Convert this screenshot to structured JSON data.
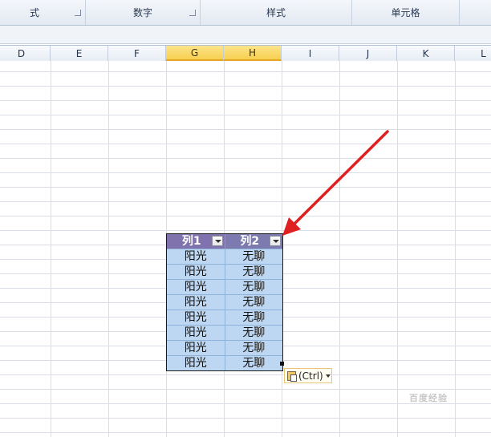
{
  "ribbon": {
    "groups": [
      {
        "label": "式",
        "has_launcher": true
      },
      {
        "label": "数字",
        "has_launcher": true
      },
      {
        "label": "样式",
        "has_launcher": false
      },
      {
        "label": "单元格",
        "has_launcher": false
      }
    ]
  },
  "columns": [
    "D",
    "E",
    "F",
    "G",
    "H",
    "I",
    "J",
    "K",
    "L"
  ],
  "selected_columns": [
    "G",
    "H"
  ],
  "table": {
    "headers": [
      "列1",
      "列2"
    ],
    "rows": [
      [
        "阳光",
        "无聊"
      ],
      [
        "阳光",
        "无聊"
      ],
      [
        "阳光",
        "无聊"
      ],
      [
        "阳光",
        "无聊"
      ],
      [
        "阳光",
        "无聊"
      ],
      [
        "阳光",
        "无聊"
      ],
      [
        "阳光",
        "无聊"
      ],
      [
        "阳光",
        "无聊"
      ]
    ],
    "header_color": "#7f72ad",
    "row_color": "#bdd7f2"
  },
  "paste_options": {
    "label": "(Ctrl)",
    "icon": "clipboard-icon"
  },
  "annotation": {
    "color": "#e02020",
    "icon": "red-arrow"
  },
  "watermark": {
    "text": "百度经验"
  }
}
